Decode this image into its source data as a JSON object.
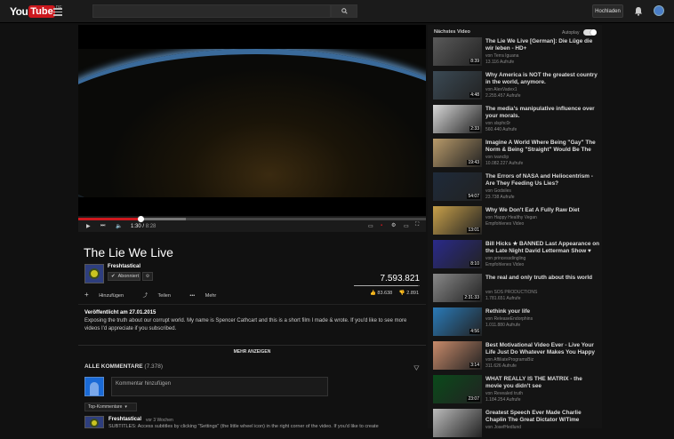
{
  "header": {
    "logo_you": "You",
    "logo_tube": "Tube",
    "logo_locale": "DE",
    "upload_label": "Hochladen"
  },
  "player": {
    "time_current": "1:30",
    "time_total": "8:28",
    "progress_played": 0.18,
    "progress_loaded": 0.31
  },
  "video": {
    "title": "The Lie We Live",
    "channel": "Freshtastical",
    "subscribe_label": "Abonniert",
    "views": "7.593.821",
    "likes": "83.638",
    "dislikes": "2.891",
    "like_ratio": 0.967,
    "actions": {
      "add": "Hinzufügen",
      "share": "Teilen",
      "more": "Mehr"
    },
    "published": "Veröffentlicht am 27.01.2015",
    "description": "Exposing the truth about our corrupt world. My name is Spencer Cathcart and this is a short film I made & wrote. If you'd like to see more videos I'd appreciate if you subscribed.",
    "show_more": "MEHR ANZEIGEN"
  },
  "comments": {
    "header": "ALLE KOMMENTARE",
    "count": "(7.378)",
    "placeholder": "Kommentar hinzufügen",
    "sort_label": "Top-Kommentare",
    "first": {
      "author": "Freshtastical",
      "time": "vor 3 Wochen",
      "text": "SUBTITLES: Access subtitles by clicking \"Settings\" (the little wheel icon) in the right corner of the video. If you'd like to create"
    }
  },
  "sidebar": {
    "heading": "Nächstes Video",
    "autoplay_label": "Autoplay",
    "items": [
      {
        "title": "The Lie We Live [German]: Die Lüge die wir leben - HD+",
        "channel": "von Terra Iguana",
        "views": "13.116 Aufrufe",
        "duration": "8:39",
        "thumb_color": "#5a5a5a"
      },
      {
        "title": "Why America is NOT the greatest country in the world, anymore.",
        "channel": "von AlexVadex1",
        "views": "2.255.457 Aufrufe",
        "duration": "4:48",
        "thumb_color": "#3b4a55"
      },
      {
        "title": "The media's manipulative influence over your morals.",
        "channel": "von slsphc0r",
        "views": "560.440 Aufrufe",
        "duration": "2:33",
        "thumb_color": "#d8d8d8"
      },
      {
        "title": "Imagine A World Where Being \"Gay\" The Norm & Being \"Straight\" Would Be The",
        "channel": "von ivanclip",
        "views": "10.082.227 Aufrufe",
        "duration": "19:43",
        "thumb_color": "#b89a6a"
      },
      {
        "title": "The Errors of NASA and Heliocentrism - Are They Feeding Us Lies?",
        "channel": "von Godsiles",
        "views": "23.738 Aufrufe",
        "duration": "54:07",
        "thumb_color": "#1e2a3a"
      },
      {
        "title": "Why We Don't Eat A Fully Raw Diet",
        "channel": "von Happy Healthy Vegan",
        "views": "Empfohlenes Video",
        "duration": "13:01",
        "thumb_color": "#c8a04a"
      },
      {
        "title": "Bill Hicks ★ BANNED Last Appearance on the Late Night David Letterman Show ♥",
        "channel": "von princessdingling",
        "views": "Empfohlenes Video",
        "duration": "8:10",
        "thumb_color": "#2a2a8a"
      },
      {
        "title": "The real and only truth about this world",
        "channel": "von SOS PRODUCTIONS",
        "views": "1.781.651 Aufrufe",
        "duration": "2:31:33",
        "thumb_color": "#888888"
      },
      {
        "title": "Rethink your life",
        "channel": "von ReleaseEndorphins",
        "views": "1.011.880 Aufrufe",
        "duration": "4:56",
        "thumb_color": "#2a7ab8"
      },
      {
        "title": "Best Motivational Video Ever - Live Your Life Just Do Whatever Makes You Happy",
        "channel": "von AffiliateProgramsBiz",
        "views": "311.626 Aufrufe",
        "duration": "3:14",
        "thumb_color": "#c88a6a"
      },
      {
        "title": "WHAT REALLY IS THE MATRIX - the movie you didn't see",
        "channel": "von Revealed truth",
        "views": "1.184.254 Aufrufe",
        "duration": "23:07",
        "thumb_color": "#0a4a1a"
      },
      {
        "title": "Greatest Speech Ever Made Charlie Chaplin The Great Dictator W/Time",
        "channel": "von JosefHedlund",
        "views": "",
        "duration": "",
        "thumb_color": "#bbbbbb"
      }
    ]
  }
}
